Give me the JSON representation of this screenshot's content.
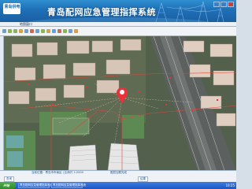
{
  "window": {
    "logo_text": "青岛供电",
    "title": "青岛配网应急管理指挥系统"
  },
  "menu": {
    "active_tab": "地图窗口"
  },
  "map": {
    "accent_color": "#e8333a",
    "marker_icon": "location-pin-icon",
    "route_color": "#d94a3a"
  },
  "status": {
    "line1": "当前位置：青岛市市南区 | 比例尺 1:2000",
    "line2": "图层加载完成",
    "tab_query": "查询",
    "tab_result": "结果"
  },
  "taskbar": {
    "start_label": "开始",
    "items": [
      "青岛配网应急管理指挥系统",
      "青岛配网应急管理指挥系统"
    ],
    "clock": "10:25"
  }
}
